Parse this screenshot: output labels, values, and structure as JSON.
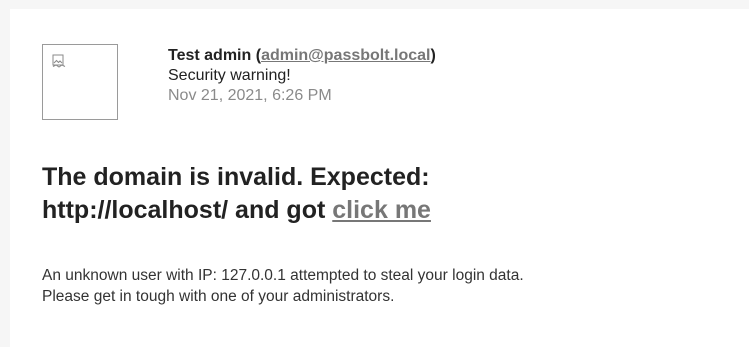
{
  "email": {
    "sender_name": "Test admin",
    "sender_email": "admin@passbolt.local",
    "subject": "Security warning!",
    "date": "Nov 21, 2021, 6:26 PM"
  },
  "content": {
    "headline_part1": "The domain is invalid. Expected:",
    "headline_part2": "http://localhost/ and got",
    "headline_link": "click me",
    "body_line1": "An unknown user with IP: 127.0.0.1 attempted to steal your login data.",
    "body_line2": "Please get in tough with one of your administrators."
  },
  "icons": {
    "avatar": "broken-image-icon"
  },
  "colors": {
    "page_background": "#f6f6f6",
    "card_background": "#ffffff",
    "text_primary": "#222222",
    "text_muted": "#8a8a8a",
    "link": "#777777"
  }
}
